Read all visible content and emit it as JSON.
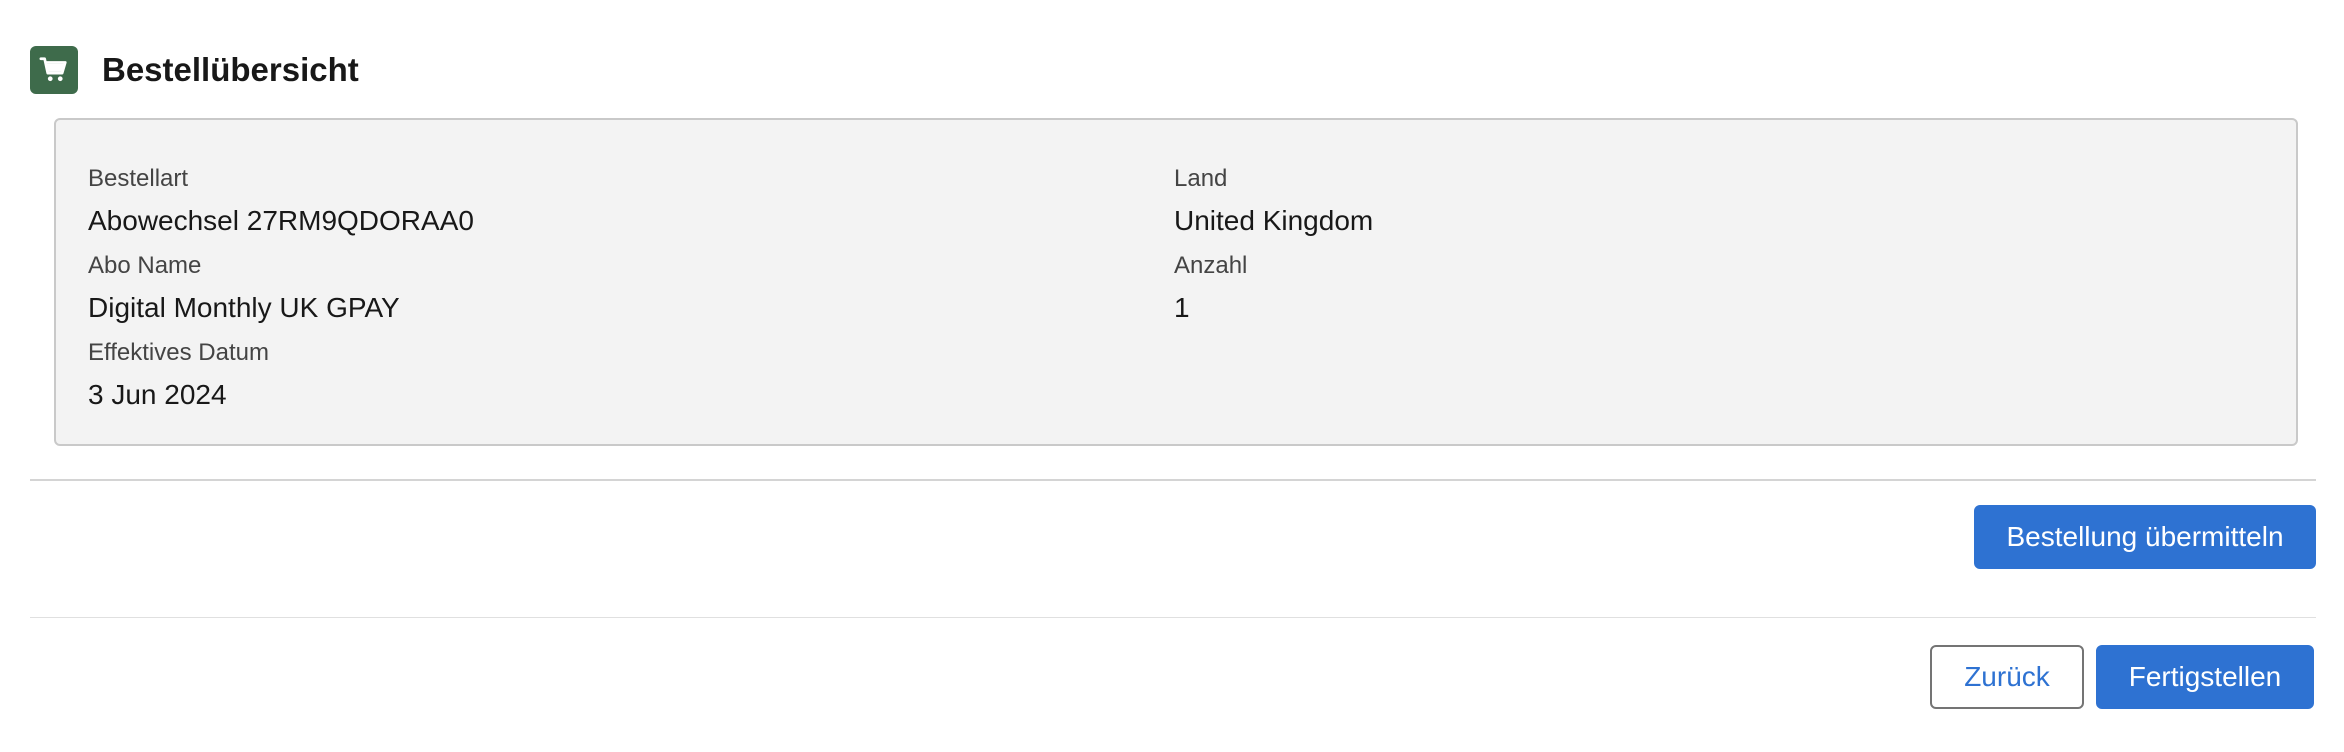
{
  "header": {
    "icon": "shopping-cart-icon",
    "icon_bg_color": "#3e6b4b",
    "title": "Bestellübersicht"
  },
  "summary": {
    "left": [
      {
        "label": "Bestellart",
        "value": "Abowechsel 27RM9QDORAA0"
      },
      {
        "label": "Abo Name",
        "value": "Digital Monthly UK GPAY"
      },
      {
        "label": "Effektives Datum",
        "value": "3 Jun 2024"
      }
    ],
    "right": [
      {
        "label": "Land",
        "value": "United Kingdom"
      },
      {
        "label": "Anzahl",
        "value": "1"
      }
    ]
  },
  "actions": {
    "submit_label": "Bestellung übermitteln"
  },
  "footer": {
    "back_label": "Zurück",
    "finish_label": "Fertigstellen"
  },
  "colors": {
    "brand": "#2e72d2",
    "panel_bg": "#f3f3f3"
  }
}
